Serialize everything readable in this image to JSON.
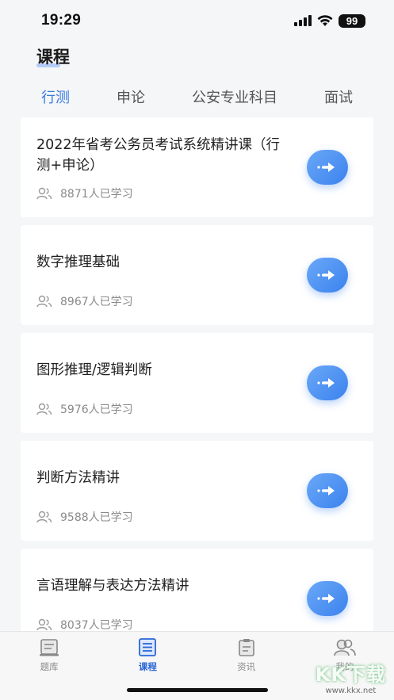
{
  "status_bar": {
    "time": "19:29",
    "battery": "99"
  },
  "page": {
    "title": "课程"
  },
  "tabs": [
    {
      "label": "行测",
      "active": true
    },
    {
      "label": "申论",
      "active": false
    },
    {
      "label": "公安专业科目",
      "active": false
    },
    {
      "label": "面试",
      "active": false
    }
  ],
  "courses": [
    {
      "title": "2022年省考公务员考试系统精讲课（行测+申论）",
      "learners": "8871人已学习"
    },
    {
      "title": "数字推理基础",
      "learners": "8967人已学习"
    },
    {
      "title": "图形推理/逻辑判断",
      "learners": "5976人已学习"
    },
    {
      "title": "判断方法精讲",
      "learners": "9588人已学习"
    },
    {
      "title": "言语理解与表达方法精讲",
      "learners": "8037人已学习"
    }
  ],
  "tab_bar": {
    "items": [
      {
        "label": "题库",
        "icon": "question-bank-icon",
        "active": false
      },
      {
        "label": "课程",
        "icon": "course-list-icon",
        "active": true
      },
      {
        "label": "资讯",
        "icon": "news-icon",
        "active": false
      },
      {
        "label": "我的",
        "icon": "profile-icon",
        "active": false
      }
    ]
  },
  "watermark": {
    "text": "KK下载",
    "url": "www.kkx.net"
  },
  "colors": {
    "accent": "#3a7be0",
    "button_gradient_start": "#6aa8f7",
    "button_gradient_end": "#3b82ee"
  }
}
